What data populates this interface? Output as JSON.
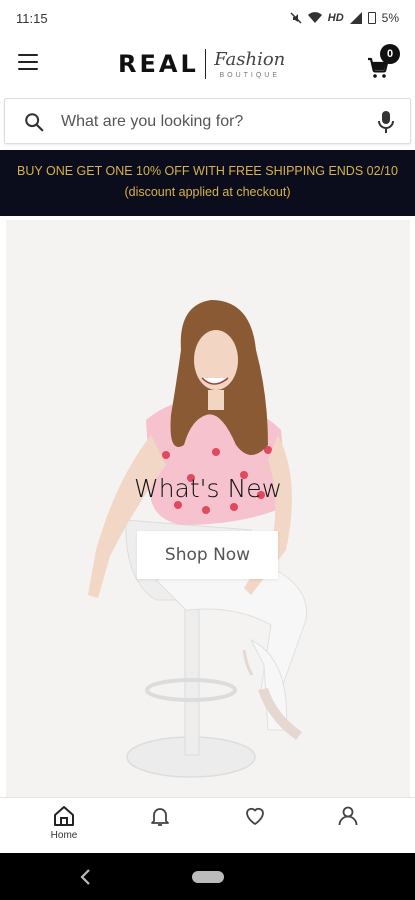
{
  "status_bar": {
    "time": "11:15",
    "network": "HD",
    "battery": "5%"
  },
  "header": {
    "logo_main": "REAL",
    "logo_script": "Fashion",
    "logo_sub": "BOUTIQUE",
    "cart_count": "0"
  },
  "search": {
    "placeholder": "What are you looking for?"
  },
  "promo": {
    "line1": "BUY ONE GET ONE 10% OFF WITH FREE SHIPPING ENDS 02/10",
    "line2": "(discount applied at checkout)",
    "background": "#0b0d1c",
    "text_color": "#d6b24a"
  },
  "hero": {
    "title": "What's New",
    "button_label": "Shop Now"
  },
  "bottom_nav": {
    "home_label": "Home",
    "items": [
      "home-icon",
      "bell-icon",
      "heart-icon",
      "user-icon"
    ]
  }
}
